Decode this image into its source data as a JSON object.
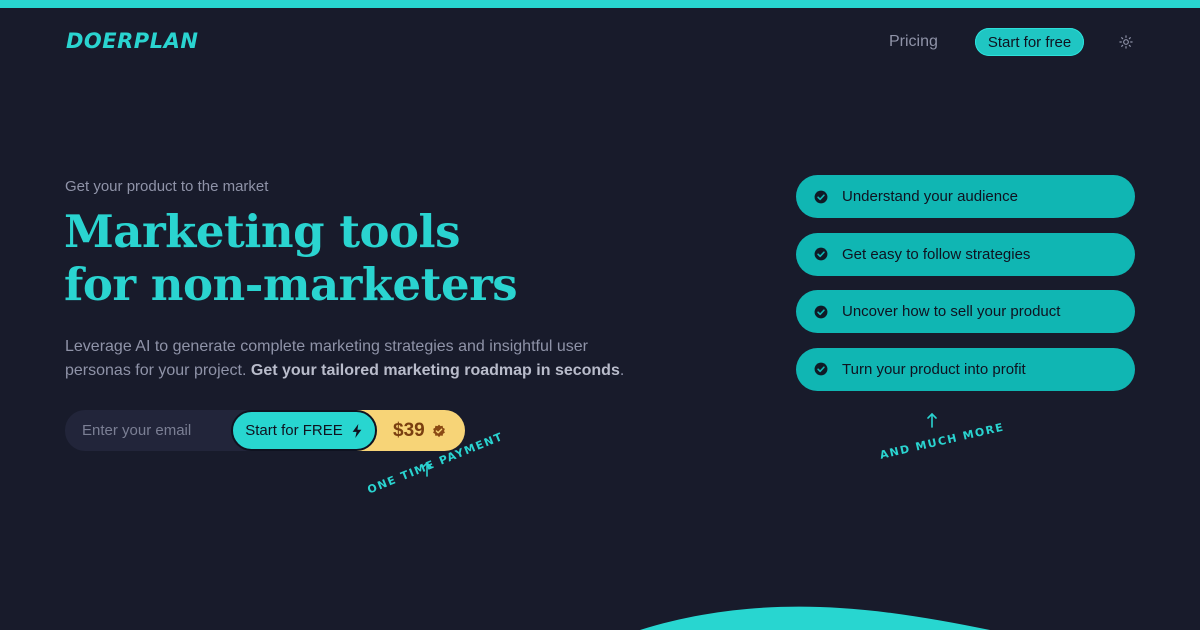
{
  "header": {
    "logo": "DOERPLAN",
    "nav": {
      "pricing": "Pricing",
      "cta": "Start for free"
    },
    "theme_toggle_icon": "sun-icon"
  },
  "hero": {
    "eyebrow": "Get your product to the market",
    "headline_line1": "Marketing tools",
    "headline_line2": "for non-marketers",
    "lede_plain": "Leverage AI to generate complete marketing strategies and insightful user personas for your project.",
    "lede_bold": "Get your tailored marketing roadmap in seconds",
    "lede_end": ".",
    "signup": {
      "email_placeholder": "Enter your email",
      "button_label": "Start for FREE",
      "button_icon": "lightning-icon",
      "price": "$39",
      "price_icon": "verified-badge-icon"
    },
    "note_one_time": "ONE TIME PAYMENT"
  },
  "features": {
    "items": [
      {
        "label": "Understand your audience"
      },
      {
        "label": "Get easy to follow strategies"
      },
      {
        "label": "Uncover how to sell your product"
      },
      {
        "label": "Turn your product into profit"
      }
    ],
    "note_more": "AND MUCH MORE"
  },
  "colors": {
    "background": "#181b2b",
    "accent": "#2ad4d0",
    "feature_pill": "#10b6b3",
    "price_tag": "#f7d477",
    "muted_text": "#8f93a8"
  }
}
